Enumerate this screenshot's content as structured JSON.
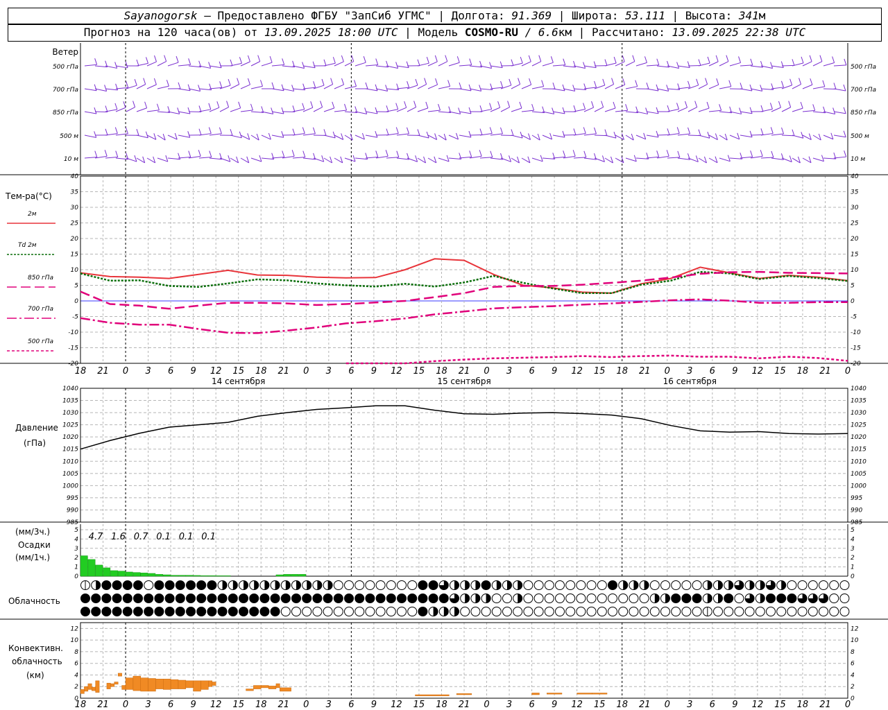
{
  "header": {
    "station": "Sayanogorsk",
    "provider": "— Предоставлено ФГБУ \"ЗапСиб УГМС\"",
    "lon_label": "Долгота:",
    "lon_value": "91.369",
    "lat_label": "Широта:",
    "lat_value": "53.111",
    "alt_label": "Высота:",
    "alt_value": "341",
    "alt_unit": "м",
    "forecast_prefix": "Прогноз на 120 часа(ов) от",
    "forecast_start": "13.09.2025 18:00 UTC",
    "model_label": "Модель",
    "model_name": "COSMO-RU",
    "model_res": "/ 6.6",
    "model_res_unit": "км",
    "computed_label": "Рассчитано:",
    "computed_time": "13.09.2025 22:38 UTC"
  },
  "chart_data": {
    "type": "line",
    "x_hours": [
      18,
      21,
      0,
      3,
      6,
      9,
      12,
      15,
      18,
      21,
      0,
      3,
      6,
      9,
      12,
      15,
      18,
      21,
      0,
      3,
      6,
      9,
      12,
      15,
      18,
      21,
      0,
      3,
      6,
      9,
      12,
      15,
      18,
      21,
      0
    ],
    "x_tick_labels": [
      "18",
      "21",
      "0",
      "3",
      "6",
      "9",
      "12",
      "15",
      "18",
      "21",
      "0",
      "3",
      "6",
      "9",
      "12",
      "15",
      "18",
      "21",
      "0",
      "3",
      "6",
      "9",
      "12",
      "15",
      "18",
      "21",
      "0",
      "3",
      "6",
      "9",
      "12",
      "15",
      "18",
      "21",
      "0"
    ],
    "day_labels": [
      "14 сентября",
      "15 сентября",
      "16 сентября"
    ],
    "wind": {
      "title": "Ветер",
      "levels": [
        "500 гПа",
        "700 гПа",
        "850 гПа",
        "500 м",
        "10  м"
      ]
    },
    "temperature": {
      "title": "Тем-ра(°C)",
      "ylim": [
        -20,
        40
      ],
      "ticks": [
        "40",
        "35",
        "30",
        "25",
        "20",
        "15",
        "10",
        "5",
        "0",
        "-5",
        "-10",
        "-15",
        "-20"
      ],
      "legend": [
        "2м",
        "Td  2м",
        "850 гПа",
        "700 гПа",
        "500 гПа"
      ],
      "colors": [
        "#e8343a",
        "#0a6e0a",
        "#e0007a",
        "#e0007a",
        "#e0007a"
      ],
      "series": [
        {
          "name": "2м",
          "values": [
            9,
            7.8,
            7.6,
            7.2,
            8.5,
            9.8,
            8.3,
            8.2,
            7.6,
            7.4,
            7.5,
            10,
            13.5,
            13,
            8.5,
            5,
            4.2,
            2.8,
            2.5,
            5.5,
            7.2,
            10.8,
            9,
            7.2,
            8.2,
            7.6,
            6.5
          ]
        },
        {
          "name": "Td  2м",
          "values": [
            8.8,
            6.5,
            6.6,
            4.8,
            4.5,
            5.6,
            6.9,
            6.6,
            5.6,
            5,
            4.6,
            5.5,
            4.6,
            5.9,
            8,
            5.8,
            4,
            2.5,
            2.5,
            5.2,
            6.5,
            9.3,
            8.8,
            7,
            8,
            7.3,
            6.4
          ]
        },
        {
          "name": "850 гПа",
          "values": [
            3,
            -1,
            -1.5,
            -2.5,
            -1.5,
            -0.6,
            -0.6,
            -0.8,
            -1.3,
            -1,
            -0.5,
            0,
            1.2,
            2.5,
            4.5,
            4.8,
            4.8,
            5.2,
            5.8,
            6.5,
            7.5,
            8.7,
            9.2,
            9.3,
            9,
            8.9,
            8.8
          ]
        },
        {
          "name": "700 гПа",
          "values": [
            -5.5,
            -7,
            -7.6,
            -7.6,
            -9,
            -10.2,
            -10.3,
            -9.5,
            -8.5,
            -7.2,
            -6.5,
            -5.6,
            -4.3,
            -3.4,
            -2.4,
            -2,
            -1.7,
            -1.2,
            -0.8,
            -0.3,
            0.2,
            0.5,
            0.1,
            -0.6,
            -0.6,
            -0.4,
            -0.4
          ]
        },
        {
          "name": "500 гПа",
          "values": [
            null,
            null,
            null,
            null,
            null,
            null,
            null,
            null,
            null,
            -20,
            -20,
            -20,
            -19.3,
            -18.8,
            -18.4,
            -18.2,
            -18,
            -17.7,
            -18,
            -17.7,
            -17.5,
            -17.9,
            -17.9,
            -18.4,
            -17.9,
            -18.3,
            -19.2
          ]
        }
      ]
    },
    "pressure": {
      "title": "Давление",
      "unit": "(гПа)",
      "ylim": [
        985,
        1040
      ],
      "ticks": [
        "1040",
        "1035",
        "1030",
        "1025",
        "1020",
        "1015",
        "1010",
        "1005",
        "1000",
        "995",
        "990",
        "985"
      ],
      "values": [
        1015,
        1018.5,
        1021.5,
        1024,
        1025,
        1026,
        1028.5,
        1030,
        1031.3,
        1032,
        1032.8,
        1032.8,
        1031,
        1029.5,
        1029.3,
        1029.8,
        1030,
        1029.6,
        1029,
        1027.5,
        1024.7,
        1022.5,
        1022,
        1022.2,
        1021.4,
        1021.2,
        1021.4
      ]
    },
    "precip": {
      "title": "Осадки",
      "unit_3h": "(мм/3ч.)",
      "unit_1h": "(мм/1ч.)",
      "ylim": [
        0,
        5
      ],
      "ticks": [
        "5",
        "4",
        "3",
        "2",
        "1",
        "0"
      ],
      "totals_3h": [
        "4.7",
        "1.6",
        "0.7",
        "0.1",
        "0.1",
        "0.1"
      ],
      "hourly_start_hour": 0,
      "hourly": [
        2.2,
        1.8,
        1.2,
        0.9,
        0.6,
        0.55,
        0.45,
        0.4,
        0.35,
        0.3,
        0.2,
        0.15,
        0.1,
        0.1,
        0.1,
        0.08,
        0.06,
        0.06,
        0.05,
        0.05,
        0,
        0,
        0,
        0,
        0,
        0,
        0.15,
        0.2,
        0.2,
        0.2
      ]
    },
    "cloudiness": {
      "title": "Облачность",
      "rows": [
        "13555505555552233233223300000000554322522200000000532200000223432430000000000002225220033020000000325222403435325321012055224252002010500000000",
        "555555555555555555555555555555555554333003000000000000335552350435554440000000000000000000000000000000000000000000000000000000000000000000000000",
        "555555555555555555500000000000005233000000000000000000000001000000000000003030000000000000000000000000000000000000000000000000000000000000000000"
      ]
    },
    "convective": {
      "title1": "Конвективн.",
      "title2": "облачность",
      "unit": "(км)",
      "ylim": [
        0,
        13
      ],
      "ticks": [
        "12",
        "10",
        "8",
        "6",
        "4",
        "2",
        "0"
      ],
      "segments": [
        [
          0,
          1,
          0.8,
          1.5
        ],
        [
          1,
          2,
          1.2,
          2
        ],
        [
          2,
          3,
          1.5,
          2.5
        ],
        [
          3,
          4,
          1.3,
          1.9
        ],
        [
          4,
          5,
          1.0,
          3.0
        ],
        [
          7,
          8,
          1.6,
          2.6
        ],
        [
          8,
          9,
          2.0,
          2.5
        ],
        [
          9,
          10,
          2.4,
          2.8
        ],
        [
          10,
          11,
          3.8,
          4.3
        ],
        [
          11,
          12,
          1.5,
          2.2
        ],
        [
          12,
          14,
          1.5,
          3.5
        ],
        [
          14,
          16,
          1.3,
          3.8
        ],
        [
          16,
          18,
          1.2,
          3.5
        ],
        [
          18,
          20,
          1.2,
          3.4
        ],
        [
          20,
          22,
          1.6,
          3.3
        ],
        [
          22,
          24,
          1.5,
          3.3
        ],
        [
          24,
          26,
          1.6,
          3.2
        ],
        [
          26,
          28,
          1.6,
          3.1
        ],
        [
          28,
          30,
          1.8,
          3.0
        ],
        [
          30,
          32,
          1.2,
          3.0
        ],
        [
          32,
          34,
          1.5,
          3.0
        ],
        [
          34,
          35,
          2.0,
          3.0
        ],
        [
          35,
          36,
          2.2,
          2.8
        ],
        [
          44,
          46,
          1.3,
          1.6
        ],
        [
          46,
          48,
          1.6,
          2.2
        ],
        [
          48,
          50,
          1.8,
          2.2
        ],
        [
          50,
          52,
          1.6,
          2.1
        ],
        [
          52,
          53,
          1.8,
          2.5
        ],
        [
          53,
          56,
          1.2,
          1.8
        ],
        [
          89,
          98,
          0.4,
          0.6
        ],
        [
          100,
          104,
          0.6,
          0.8
        ],
        [
          120,
          122,
          0.6,
          0.9
        ],
        [
          124,
          128,
          0.7,
          0.9
        ],
        [
          132,
          136,
          0.7,
          0.9
        ],
        [
          136,
          140,
          0.7,
          0.9
        ]
      ]
    }
  }
}
